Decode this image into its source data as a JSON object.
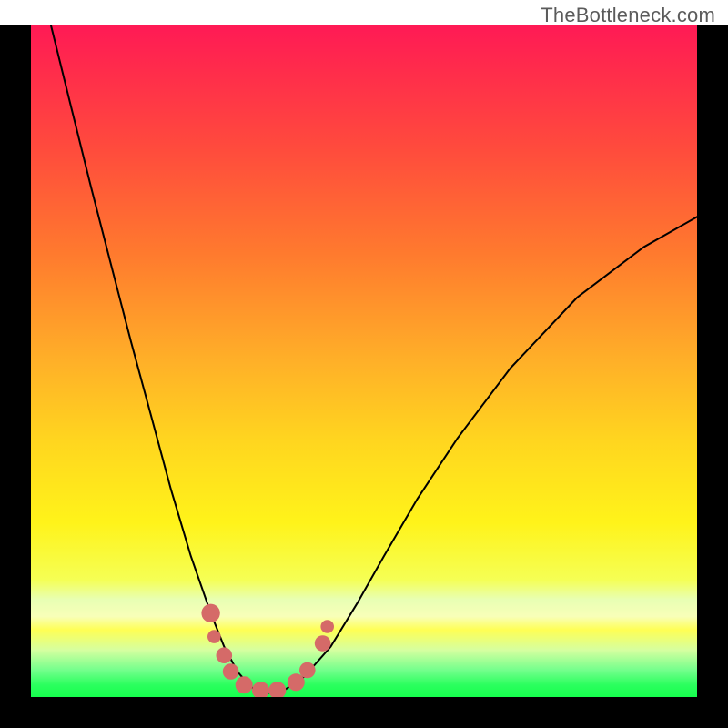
{
  "watermark": "TheBottleneck.com",
  "colors": {
    "frame": "#000000",
    "curve": "#000000",
    "marker": "#d56a68",
    "watermark_text": "#5b5b5b"
  },
  "chart_data": {
    "type": "line",
    "title": "",
    "xlabel": "",
    "ylabel": "",
    "xlim": [
      0,
      1
    ],
    "ylim": [
      0,
      1
    ],
    "grid": false,
    "note": "Axes carry no numeric labels or ticks in the source image; values below are normalized to the plotting area (0..1 on both axes, y=1 at top).",
    "series": [
      {
        "name": "bottleneck-curve",
        "x": [
          0.03,
          0.06,
          0.09,
          0.12,
          0.15,
          0.18,
          0.21,
          0.24,
          0.27,
          0.29,
          0.31,
          0.33,
          0.345,
          0.36,
          0.38,
          0.41,
          0.45,
          0.49,
          0.53,
          0.58,
          0.64,
          0.72,
          0.82,
          0.92,
          1.0
        ],
        "y": [
          1.0,
          0.88,
          0.76,
          0.645,
          0.53,
          0.42,
          0.31,
          0.21,
          0.125,
          0.075,
          0.038,
          0.015,
          0.007,
          0.006,
          0.01,
          0.03,
          0.075,
          0.14,
          0.21,
          0.295,
          0.385,
          0.49,
          0.595,
          0.67,
          0.715
        ]
      }
    ],
    "markers": [
      {
        "x": 0.27,
        "y": 0.125,
        "r": 0.014
      },
      {
        "x": 0.275,
        "y": 0.09,
        "r": 0.01
      },
      {
        "x": 0.29,
        "y": 0.062,
        "r": 0.012
      },
      {
        "x": 0.3,
        "y": 0.038,
        "r": 0.012
      },
      {
        "x": 0.32,
        "y": 0.018,
        "r": 0.013
      },
      {
        "x": 0.345,
        "y": 0.01,
        "r": 0.013
      },
      {
        "x": 0.37,
        "y": 0.01,
        "r": 0.013
      },
      {
        "x": 0.398,
        "y": 0.022,
        "r": 0.013
      },
      {
        "x": 0.415,
        "y": 0.04,
        "r": 0.012
      },
      {
        "x": 0.438,
        "y": 0.08,
        "r": 0.012
      },
      {
        "x": 0.445,
        "y": 0.105,
        "r": 0.01
      }
    ]
  }
}
